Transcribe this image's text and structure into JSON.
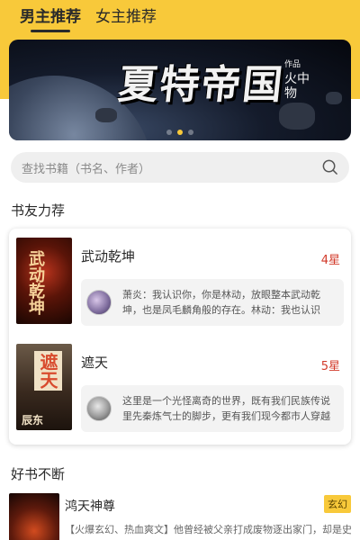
{
  "tabs": [
    {
      "label": "男主推荐",
      "active": true
    },
    {
      "label": "女主推荐",
      "active": false
    }
  ],
  "banner": {
    "title": "夏特帝国",
    "author_label": "火中物",
    "author_tag": "作品",
    "accent": "#f8c93a"
  },
  "search": {
    "placeholder": "查找书籍（书名、作者）"
  },
  "section_recommend": {
    "title": "书友力荐"
  },
  "recommended": [
    {
      "name": "武动乾坤",
      "stars": "4星",
      "cover_text": "武动乾坤",
      "quote": "萧炎：我认识你，你是林动，放眼整本武动乾坤，也是凤毛麟角般的存在。林动：我也认识你，你是萧炎，一出手..."
    },
    {
      "name": "遮天",
      "stars": "5星",
      "cover_text": "遮天",
      "cover_author": "辰东",
      "quote": "这里是一个光怪离奇的世界，既有我们民族传说里先秦炼气士的脚步，更有我们现今都市人穿越重重障碍，经历悲欢..."
    }
  ],
  "section_good": {
    "title": "好书不断"
  },
  "good_books": [
    {
      "name": "鸿天神尊",
      "tag": "玄幻",
      "desc": "【火爆玄幻、热血爽文】他曾经被父亲打成废物逐出家门，却是史上"
    }
  ],
  "colors": {
    "accent": "#f8c93a",
    "star": "#d23a2a"
  }
}
